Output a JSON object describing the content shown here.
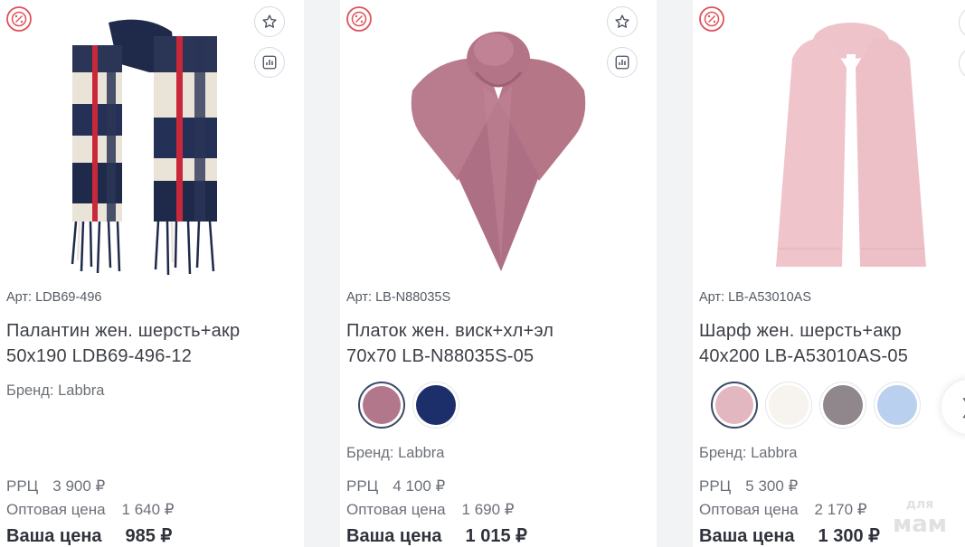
{
  "products": [
    {
      "sku": "Арт: LDB69-496",
      "title_line1": "Палантин жен. шерсть+акр",
      "title_line2": "50x190 LDB69-496-12",
      "brand": "Бренд: Labbra",
      "rrp_label": "РРЦ",
      "rrp_value": "3 900 ₽",
      "wholesale_label": "Оптовая цена",
      "wholesale_value": "1 640 ₽",
      "your_price_label": "Ваша цена",
      "your_price_value": "985 ₽",
      "icons": [
        "promo-icon",
        "star-icon",
        "chart-icon"
      ],
      "colors": [
        "#1f2a4a",
        "#c8283a",
        "#efe8dc"
      ]
    },
    {
      "sku": "Арт: LB-N88035S",
      "title_line1": "Платок жен. виск+хл+эл",
      "title_line2": "70x70 LB-N88035S-05",
      "brand": "Бренд: Labbra",
      "swatches": [
        {
          "color": "#b2778b",
          "selected": true
        },
        {
          "color": "#1d2f6b",
          "selected": false
        }
      ],
      "rrp_label": "РРЦ",
      "rrp_value": "4 100 ₽",
      "wholesale_label": "Оптовая цена",
      "wholesale_value": "1 690 ₽",
      "your_price_label": "Ваша цена",
      "your_price_value": "1 015 ₽",
      "icons": [
        "promo-icon",
        "star-icon",
        "chart-icon"
      ],
      "colors": [
        "#b97b8e"
      ]
    },
    {
      "sku": "Арт: LB-A53010AS",
      "title_line1": "Шарф жен. шерсть+акр",
      "title_line2": "40x200 LB-A53010AS-05",
      "brand": "Бренд: Labbra",
      "swatches": [
        {
          "color": "#e3b7c0",
          "selected": true
        },
        {
          "color": "#f7f3ee",
          "selected": false
        },
        {
          "color": "#8f878c",
          "selected": false
        },
        {
          "color": "#b9d1ee",
          "selected": false
        }
      ],
      "rrp_label": "РРЦ",
      "rrp_value": "5 300 ₽",
      "wholesale_label": "Оптовая цена",
      "wholesale_value": "2 170 ₽",
      "your_price_label": "Ваша цена",
      "your_price_value": "1 300 ₽",
      "icons": [
        "promo-icon",
        "star-icon",
        "chart-icon"
      ],
      "colors": [
        "#efc4cb"
      ]
    }
  ],
  "watermark": {
    "line1": "для",
    "line2": "мам"
  },
  "next_arrow_glyph": "❯",
  "accent_colors": {
    "promo": "#e0525b",
    "text": "#3c3f46",
    "selected_border": "#3d4a67"
  }
}
